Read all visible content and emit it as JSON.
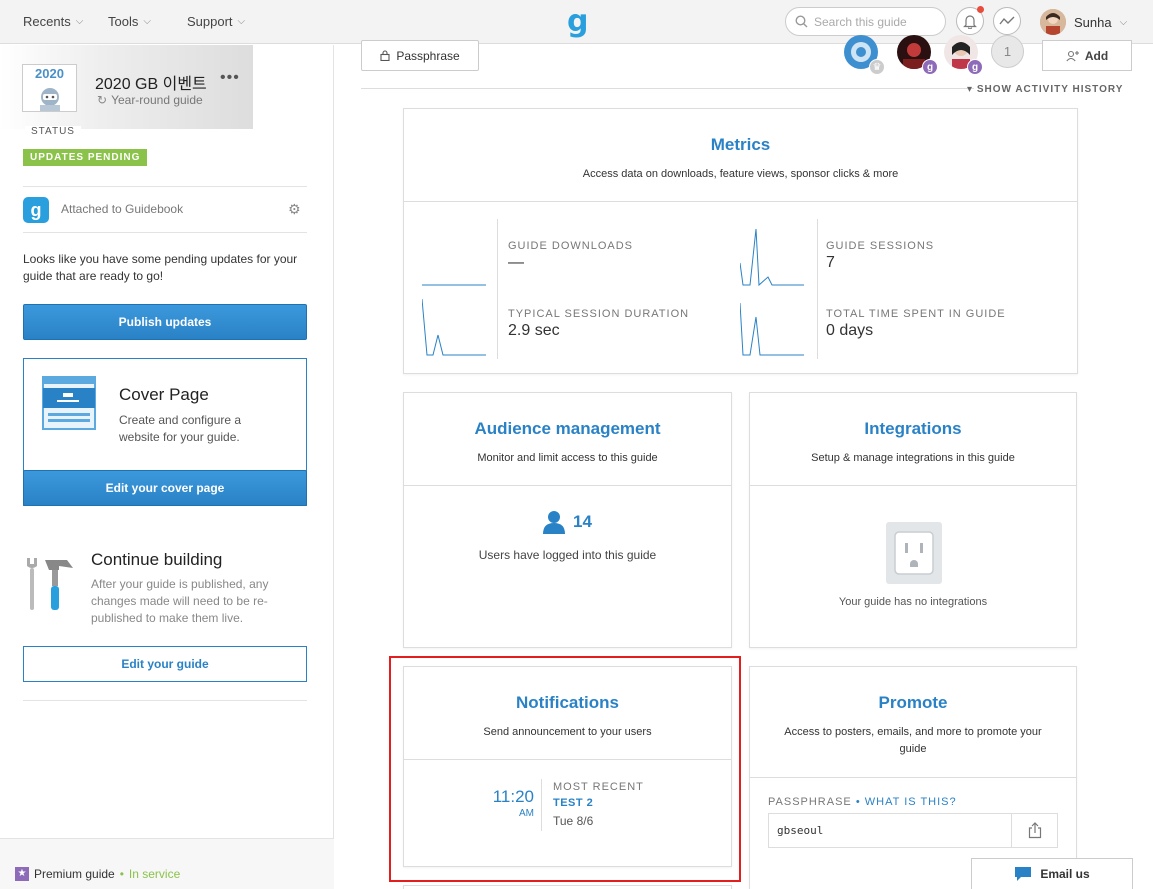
{
  "topbar": {
    "nav": [
      {
        "label": "Recents"
      },
      {
        "label": "Tools"
      },
      {
        "label": "Support"
      }
    ],
    "logo": "g",
    "search_placeholder": "Search this guide",
    "user_name": "Sunha"
  },
  "sidebar": {
    "guide_thumb_text": "2020",
    "guide_title": "2020 GB 이벤트",
    "more_dots": "•••",
    "guide_type": "Year-round guide",
    "status_label": "STATUS",
    "status_badge": "UPDATES PENDING",
    "attached_icon": "g",
    "attached_label": "Attached to Guidebook",
    "pending_text": "Looks like you have some pending updates for your guide that are ready to go!",
    "publish_button": "Publish updates",
    "cover_title": "Cover Page",
    "cover_desc": "Create and configure a website for your guide.",
    "cover_button": "Edit your cover page",
    "continue_title": "Continue building",
    "continue_desc": "After your guide is published, any changes made will need to be re-published to make them live.",
    "edit_guide_button": "Edit your guide",
    "premium_label": "Premium guide",
    "premium_sep": "•",
    "premium_status": "In service"
  },
  "header": {
    "passphrase_button": "Passphrase",
    "more_collaborators": "1",
    "add_button": "Add",
    "activity_history": "SHOW ACTIVITY HISTORY",
    "collab_badge": "g"
  },
  "metrics": {
    "title": "Metrics",
    "subtitle": "Access data on downloads, feature views, sponsor clicks & more",
    "items": [
      {
        "label": "GUIDE DOWNLOADS",
        "value": "—"
      },
      {
        "label": "GUIDE SESSIONS",
        "value": "7"
      },
      {
        "label": "TYPICAL SESSION DURATION",
        "value": "2.9 sec"
      },
      {
        "label": "TOTAL TIME SPENT IN GUIDE",
        "value": "0 days"
      }
    ]
  },
  "audience": {
    "title": "Audience management",
    "subtitle": "Monitor and limit access to this guide",
    "count": "14",
    "desc": "Users have logged into this guide"
  },
  "integrations": {
    "title": "Integrations",
    "subtitle": "Setup & manage integrations in this guide",
    "empty_text": "Your guide has no integrations"
  },
  "notifications": {
    "title": "Notifications",
    "subtitle": "Send announcement to your users",
    "time": "11:20",
    "ampm": "AM",
    "recent_label": "MOST RECENT",
    "recent_title": "TEST 2",
    "recent_date": "Tue 8/6"
  },
  "promote": {
    "title": "Promote",
    "subtitle": "Access to posters, emails, and more to promote your guide",
    "passphrase_label": "PASSPHRASE",
    "sep": "•",
    "what_is_this": "WHAT IS THIS?",
    "passphrase_value": "gbseoul"
  },
  "email_us": "Email us",
  "colors": {
    "accent": "#2a82c6",
    "brand": "#29a0dd",
    "green": "#8bc34a",
    "highlight": "#e41e1e"
  }
}
